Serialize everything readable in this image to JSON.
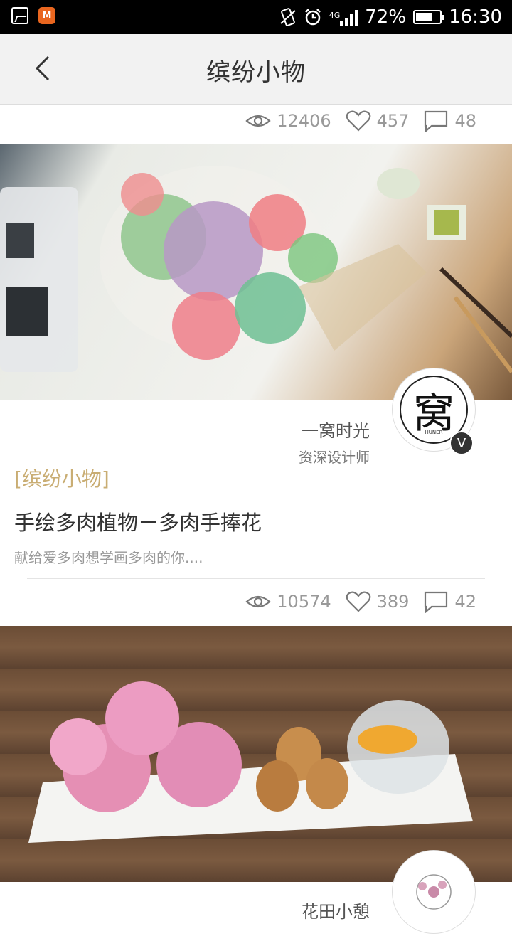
{
  "status_bar": {
    "battery": "72%",
    "battery_level": 0.72,
    "time": "16:30",
    "network": "4G"
  },
  "header": {
    "title": "缤纷小物"
  },
  "cards": [
    {
      "stats": {
        "views": "12406",
        "likes": "457",
        "comments": "48"
      }
    },
    {
      "author": {
        "name": "一窝时光",
        "role": "资深设计师",
        "avatar_text": "窝",
        "avatar_subtext": "HUNER",
        "badge": "V"
      },
      "category": "[缤纷小物]",
      "title": "手绘多肉植物－多肉手捧花",
      "description": "献给爱多肉想学画多肉的你....",
      "stats": {
        "views": "10574",
        "likes": "389",
        "comments": "42"
      }
    },
    {
      "author": {
        "name": "花田小憩"
      }
    }
  ],
  "colors": {
    "category": "#c9ad73",
    "stat_gray": "#999999",
    "titlebar": "#f2f2f2"
  }
}
